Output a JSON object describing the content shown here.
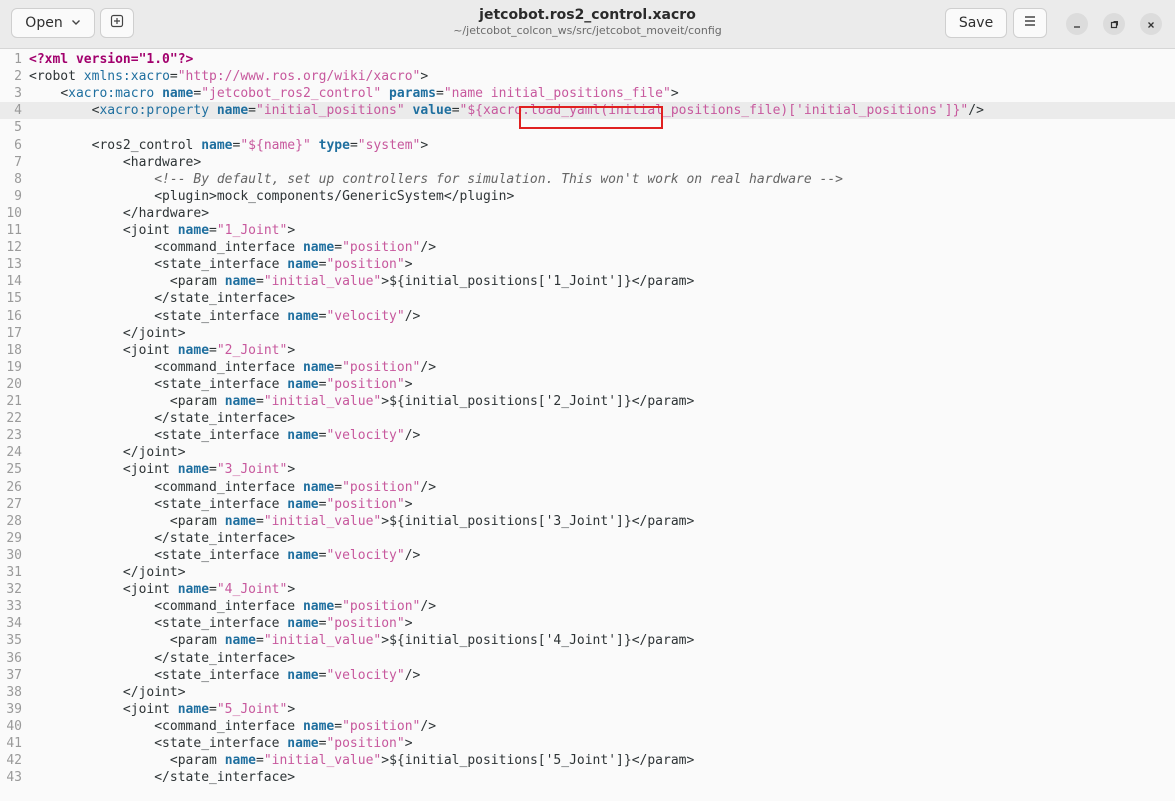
{
  "titlebar": {
    "open_label": "Open",
    "title": "jetcobot.ros2_control.xacro",
    "subtitle": "~/jetcobot_colcon_ws/src/jetcobot_moveit/config",
    "save_label": "Save"
  },
  "icons": {
    "open_dropdown": "chevron-down-icon",
    "new_tab": "new-tab-icon",
    "menu": "hamburger-menu-icon",
    "minimize": "minimize-icon",
    "maximize": "maximize-icon",
    "close": "close-icon"
  },
  "colors": {
    "highlight_box": "#e02020",
    "processing_instruction": "#a2006d",
    "attribute": "#1f6f9f",
    "string": "#c7589d",
    "comment": "#656565"
  },
  "editor": {
    "current_line": 4,
    "lines": [
      {
        "n": "1",
        "seg": [
          [
            "pi",
            "<?xml version=\"1.0\"?>"
          ]
        ]
      },
      {
        "n": "2",
        "seg": [
          [
            "tag",
            "<robot "
          ],
          [
            "ns",
            "xmlns:xacro"
          ],
          [
            "tag",
            "="
          ],
          [
            "str",
            "\"http://www.ros.org/wiki/xacro\""
          ],
          [
            "tag",
            ">"
          ]
        ]
      },
      {
        "n": "3",
        "seg": [
          [
            "txt",
            "    "
          ],
          [
            "tag",
            "<"
          ],
          [
            "ns",
            "xacro:macro "
          ],
          [
            "attr",
            "name"
          ],
          [
            "tag",
            "="
          ],
          [
            "str",
            "\"jetcobot_ros2_control\" "
          ],
          [
            "attr",
            "params"
          ],
          [
            "tag",
            "="
          ],
          [
            "str",
            "\"name initial_positions_file\""
          ],
          [
            "tag",
            ">"
          ]
        ]
      },
      {
        "n": "4",
        "seg": [
          [
            "txt",
            "        "
          ],
          [
            "tag",
            "<"
          ],
          [
            "ns",
            "xacro:property "
          ],
          [
            "attr",
            "name"
          ],
          [
            "tag",
            "="
          ],
          [
            "str",
            "\"initial_positions\" "
          ],
          [
            "attr",
            "value"
          ],
          [
            "tag",
            "="
          ],
          [
            "str",
            "\"${xacro.load_yaml(initial_positions_file)['initial_positions']}\""
          ],
          [
            "tag",
            "/>"
          ]
        ]
      },
      {
        "n": "5",
        "seg": []
      },
      {
        "n": "6",
        "seg": [
          [
            "txt",
            "        "
          ],
          [
            "tag",
            "<ros2_control "
          ],
          [
            "attr",
            "name"
          ],
          [
            "tag",
            "="
          ],
          [
            "str",
            "\"${name}\" "
          ],
          [
            "attr",
            "type"
          ],
          [
            "tag",
            "="
          ],
          [
            "str",
            "\"system\""
          ],
          [
            "tag",
            ">"
          ]
        ]
      },
      {
        "n": "7",
        "seg": [
          [
            "txt",
            "            "
          ],
          [
            "tag",
            "<hardware>"
          ]
        ]
      },
      {
        "n": "8",
        "seg": [
          [
            "txt",
            "                "
          ],
          [
            "cm",
            "<!-- By default, set up controllers for simulation. This won't work on real hardware -->"
          ]
        ]
      },
      {
        "n": "9",
        "seg": [
          [
            "txt",
            "                "
          ],
          [
            "tag",
            "<plugin>"
          ],
          [
            "txt",
            "mock_components/GenericSystem"
          ],
          [
            "tag",
            "</plugin>"
          ]
        ]
      },
      {
        "n": "10",
        "seg": [
          [
            "txt",
            "            "
          ],
          [
            "tag",
            "</hardware>"
          ]
        ]
      },
      {
        "n": "11",
        "seg": [
          [
            "txt",
            "            "
          ],
          [
            "tag",
            "<joint "
          ],
          [
            "attr",
            "name"
          ],
          [
            "tag",
            "="
          ],
          [
            "str",
            "\"1_Joint\""
          ],
          [
            "tag",
            ">"
          ]
        ]
      },
      {
        "n": "12",
        "seg": [
          [
            "txt",
            "                "
          ],
          [
            "tag",
            "<command_interface "
          ],
          [
            "attr",
            "name"
          ],
          [
            "tag",
            "="
          ],
          [
            "str",
            "\"position\""
          ],
          [
            "tag",
            "/>"
          ]
        ]
      },
      {
        "n": "13",
        "seg": [
          [
            "txt",
            "                "
          ],
          [
            "tag",
            "<state_interface "
          ],
          [
            "attr",
            "name"
          ],
          [
            "tag",
            "="
          ],
          [
            "str",
            "\"position\""
          ],
          [
            "tag",
            ">"
          ]
        ]
      },
      {
        "n": "14",
        "seg": [
          [
            "txt",
            "                  "
          ],
          [
            "tag",
            "<param "
          ],
          [
            "attr",
            "name"
          ],
          [
            "tag",
            "="
          ],
          [
            "str",
            "\"initial_value\""
          ],
          [
            "tag",
            ">"
          ],
          [
            "txt",
            "${initial_positions['1_Joint']}"
          ],
          [
            "tag",
            "</param>"
          ]
        ]
      },
      {
        "n": "15",
        "seg": [
          [
            "txt",
            "                "
          ],
          [
            "tag",
            "</state_interface>"
          ]
        ]
      },
      {
        "n": "16",
        "seg": [
          [
            "txt",
            "                "
          ],
          [
            "tag",
            "<state_interface "
          ],
          [
            "attr",
            "name"
          ],
          [
            "tag",
            "="
          ],
          [
            "str",
            "\"velocity\""
          ],
          [
            "tag",
            "/>"
          ]
        ]
      },
      {
        "n": "17",
        "seg": [
          [
            "txt",
            "            "
          ],
          [
            "tag",
            "</joint>"
          ]
        ]
      },
      {
        "n": "18",
        "seg": [
          [
            "txt",
            "            "
          ],
          [
            "tag",
            "<joint "
          ],
          [
            "attr",
            "name"
          ],
          [
            "tag",
            "="
          ],
          [
            "str",
            "\"2_Joint\""
          ],
          [
            "tag",
            ">"
          ]
        ]
      },
      {
        "n": "19",
        "seg": [
          [
            "txt",
            "                "
          ],
          [
            "tag",
            "<command_interface "
          ],
          [
            "attr",
            "name"
          ],
          [
            "tag",
            "="
          ],
          [
            "str",
            "\"position\""
          ],
          [
            "tag",
            "/>"
          ]
        ]
      },
      {
        "n": "20",
        "seg": [
          [
            "txt",
            "                "
          ],
          [
            "tag",
            "<state_interface "
          ],
          [
            "attr",
            "name"
          ],
          [
            "tag",
            "="
          ],
          [
            "str",
            "\"position\""
          ],
          [
            "tag",
            ">"
          ]
        ]
      },
      {
        "n": "21",
        "seg": [
          [
            "txt",
            "                  "
          ],
          [
            "tag",
            "<param "
          ],
          [
            "attr",
            "name"
          ],
          [
            "tag",
            "="
          ],
          [
            "str",
            "\"initial_value\""
          ],
          [
            "tag",
            ">"
          ],
          [
            "txt",
            "${initial_positions['2_Joint']}"
          ],
          [
            "tag",
            "</param>"
          ]
        ]
      },
      {
        "n": "22",
        "seg": [
          [
            "txt",
            "                "
          ],
          [
            "tag",
            "</state_interface>"
          ]
        ]
      },
      {
        "n": "23",
        "seg": [
          [
            "txt",
            "                "
          ],
          [
            "tag",
            "<state_interface "
          ],
          [
            "attr",
            "name"
          ],
          [
            "tag",
            "="
          ],
          [
            "str",
            "\"velocity\""
          ],
          [
            "tag",
            "/>"
          ]
        ]
      },
      {
        "n": "24",
        "seg": [
          [
            "txt",
            "            "
          ],
          [
            "tag",
            "</joint>"
          ]
        ]
      },
      {
        "n": "25",
        "seg": [
          [
            "txt",
            "            "
          ],
          [
            "tag",
            "<joint "
          ],
          [
            "attr",
            "name"
          ],
          [
            "tag",
            "="
          ],
          [
            "str",
            "\"3_Joint\""
          ],
          [
            "tag",
            ">"
          ]
        ]
      },
      {
        "n": "26",
        "seg": [
          [
            "txt",
            "                "
          ],
          [
            "tag",
            "<command_interface "
          ],
          [
            "attr",
            "name"
          ],
          [
            "tag",
            "="
          ],
          [
            "str",
            "\"position\""
          ],
          [
            "tag",
            "/>"
          ]
        ]
      },
      {
        "n": "27",
        "seg": [
          [
            "txt",
            "                "
          ],
          [
            "tag",
            "<state_interface "
          ],
          [
            "attr",
            "name"
          ],
          [
            "tag",
            "="
          ],
          [
            "str",
            "\"position\""
          ],
          [
            "tag",
            ">"
          ]
        ]
      },
      {
        "n": "28",
        "seg": [
          [
            "txt",
            "                  "
          ],
          [
            "tag",
            "<param "
          ],
          [
            "attr",
            "name"
          ],
          [
            "tag",
            "="
          ],
          [
            "str",
            "\"initial_value\""
          ],
          [
            "tag",
            ">"
          ],
          [
            "txt",
            "${initial_positions['3_Joint']}"
          ],
          [
            "tag",
            "</param>"
          ]
        ]
      },
      {
        "n": "29",
        "seg": [
          [
            "txt",
            "                "
          ],
          [
            "tag",
            "</state_interface>"
          ]
        ]
      },
      {
        "n": "30",
        "seg": [
          [
            "txt",
            "                "
          ],
          [
            "tag",
            "<state_interface "
          ],
          [
            "attr",
            "name"
          ],
          [
            "tag",
            "="
          ],
          [
            "str",
            "\"velocity\""
          ],
          [
            "tag",
            "/>"
          ]
        ]
      },
      {
        "n": "31",
        "seg": [
          [
            "txt",
            "            "
          ],
          [
            "tag",
            "</joint>"
          ]
        ]
      },
      {
        "n": "32",
        "seg": [
          [
            "txt",
            "            "
          ],
          [
            "tag",
            "<joint "
          ],
          [
            "attr",
            "name"
          ],
          [
            "tag",
            "="
          ],
          [
            "str",
            "\"4_Joint\""
          ],
          [
            "tag",
            ">"
          ]
        ]
      },
      {
        "n": "33",
        "seg": [
          [
            "txt",
            "                "
          ],
          [
            "tag",
            "<command_interface "
          ],
          [
            "attr",
            "name"
          ],
          [
            "tag",
            "="
          ],
          [
            "str",
            "\"position\""
          ],
          [
            "tag",
            "/>"
          ]
        ]
      },
      {
        "n": "34",
        "seg": [
          [
            "txt",
            "                "
          ],
          [
            "tag",
            "<state_interface "
          ],
          [
            "attr",
            "name"
          ],
          [
            "tag",
            "="
          ],
          [
            "str",
            "\"position\""
          ],
          [
            "tag",
            ">"
          ]
        ]
      },
      {
        "n": "35",
        "seg": [
          [
            "txt",
            "                  "
          ],
          [
            "tag",
            "<param "
          ],
          [
            "attr",
            "name"
          ],
          [
            "tag",
            "="
          ],
          [
            "str",
            "\"initial_value\""
          ],
          [
            "tag",
            ">"
          ],
          [
            "txt",
            "${initial_positions['4_Joint']}"
          ],
          [
            "tag",
            "</param>"
          ]
        ]
      },
      {
        "n": "36",
        "seg": [
          [
            "txt",
            "                "
          ],
          [
            "tag",
            "</state_interface>"
          ]
        ]
      },
      {
        "n": "37",
        "seg": [
          [
            "txt",
            "                "
          ],
          [
            "tag",
            "<state_interface "
          ],
          [
            "attr",
            "name"
          ],
          [
            "tag",
            "="
          ],
          [
            "str",
            "\"velocity\""
          ],
          [
            "tag",
            "/>"
          ]
        ]
      },
      {
        "n": "38",
        "seg": [
          [
            "txt",
            "            "
          ],
          [
            "tag",
            "</joint>"
          ]
        ]
      },
      {
        "n": "39",
        "seg": [
          [
            "txt",
            "            "
          ],
          [
            "tag",
            "<joint "
          ],
          [
            "attr",
            "name"
          ],
          [
            "tag",
            "="
          ],
          [
            "str",
            "\"5_Joint\""
          ],
          [
            "tag",
            ">"
          ]
        ]
      },
      {
        "n": "40",
        "seg": [
          [
            "txt",
            "                "
          ],
          [
            "tag",
            "<command_interface "
          ],
          [
            "attr",
            "name"
          ],
          [
            "tag",
            "="
          ],
          [
            "str",
            "\"position\""
          ],
          [
            "tag",
            "/>"
          ]
        ]
      },
      {
        "n": "41",
        "seg": [
          [
            "txt",
            "                "
          ],
          [
            "tag",
            "<state_interface "
          ],
          [
            "attr",
            "name"
          ],
          [
            "tag",
            "="
          ],
          [
            "str",
            "\"position\""
          ],
          [
            "tag",
            ">"
          ]
        ]
      },
      {
        "n": "42",
        "seg": [
          [
            "txt",
            "                  "
          ],
          [
            "tag",
            "<param "
          ],
          [
            "attr",
            "name"
          ],
          [
            "tag",
            "="
          ],
          [
            "str",
            "\"initial_value\""
          ],
          [
            "tag",
            ">"
          ],
          [
            "txt",
            "${initial_positions['5_Joint']}"
          ],
          [
            "tag",
            "</param>"
          ]
        ]
      },
      {
        "n": "43",
        "seg": [
          [
            "txt",
            "                "
          ],
          [
            "tag",
            "</state_interface>"
          ]
        ]
      }
    ]
  }
}
